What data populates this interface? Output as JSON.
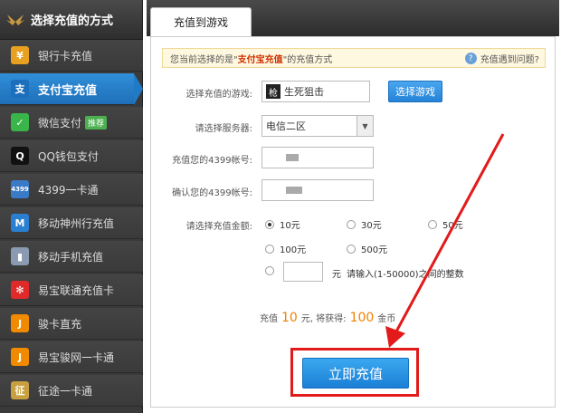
{
  "sidebar": {
    "title": "选择充值的方式",
    "items": [
      {
        "label": "银行卡充值",
        "icon": "yen-icon",
        "icon_char": "¥",
        "color": "#e8a020"
      },
      {
        "label": "支付宝充值",
        "icon": "shield-icon",
        "icon_char": "支",
        "color": "#1c6fbc",
        "active": true
      },
      {
        "label": "微信支付",
        "icon": "wechat-icon",
        "icon_char": "✓",
        "color": "#39b54a",
        "badge": "推荐"
      },
      {
        "label": "QQ钱包支付",
        "icon": "qq-penguin-icon",
        "icon_char": "Q",
        "color": "#111111"
      },
      {
        "label": "4399一卡通",
        "icon": "card-icon",
        "icon_char": "4399",
        "color": "#3a7bc8"
      },
      {
        "label": "移动神州行充值",
        "icon": "mobile-icon",
        "icon_char": "M",
        "color": "#2a7fd0"
      },
      {
        "label": "移动手机充值",
        "icon": "phone-icon",
        "icon_char": "▮",
        "color": "#8a9ab0"
      },
      {
        "label": "易宝联通充值卡",
        "icon": "unicom-icon",
        "icon_char": "✻",
        "color": "#e02a2a"
      },
      {
        "label": "骏卡直充",
        "icon": "junka-icon",
        "icon_char": "J",
        "color": "#f08a00"
      },
      {
        "label": "易宝骏网一卡通",
        "icon": "junnet-icon",
        "icon_char": "J",
        "color": "#f08a00"
      },
      {
        "label": "征途一卡通",
        "icon": "zhengtu-icon",
        "icon_char": "征",
        "color": "#c8a040"
      }
    ]
  },
  "tab": {
    "label": "充值到游戏"
  },
  "notice": {
    "prefix": "您当前选择的是\"",
    "highlight": "支付宝充值",
    "suffix": "\"的充值方式",
    "help": "充值遇到问题?"
  },
  "form": {
    "game_label": "选择充值的游戏:",
    "game_icon_char": "枪",
    "game_value": "生死狙击",
    "choose_game_button": "选择游戏",
    "server_label": "请选择服务器:",
    "server_value": "电信二区",
    "account_label": "充值您的4399帐号:",
    "confirm_label": "确认您的4399帐号:",
    "amount_label": "请选择充值金额:",
    "amounts": [
      "10元",
      "30元",
      "50元",
      "100元",
      "500元"
    ],
    "selected_amount": "10元",
    "custom_unit": "元",
    "custom_hint": "请输入(1-50000)之间的整数"
  },
  "summary": {
    "prefix": "充值",
    "amount": "10",
    "middle": "元, 将获得:",
    "coins": "100",
    "suffix": "金币"
  },
  "submit": {
    "label": "立即充值"
  },
  "colors": {
    "accent": "#1f7fd6",
    "highlight": "#e21a1a",
    "orange": "#f08000"
  }
}
